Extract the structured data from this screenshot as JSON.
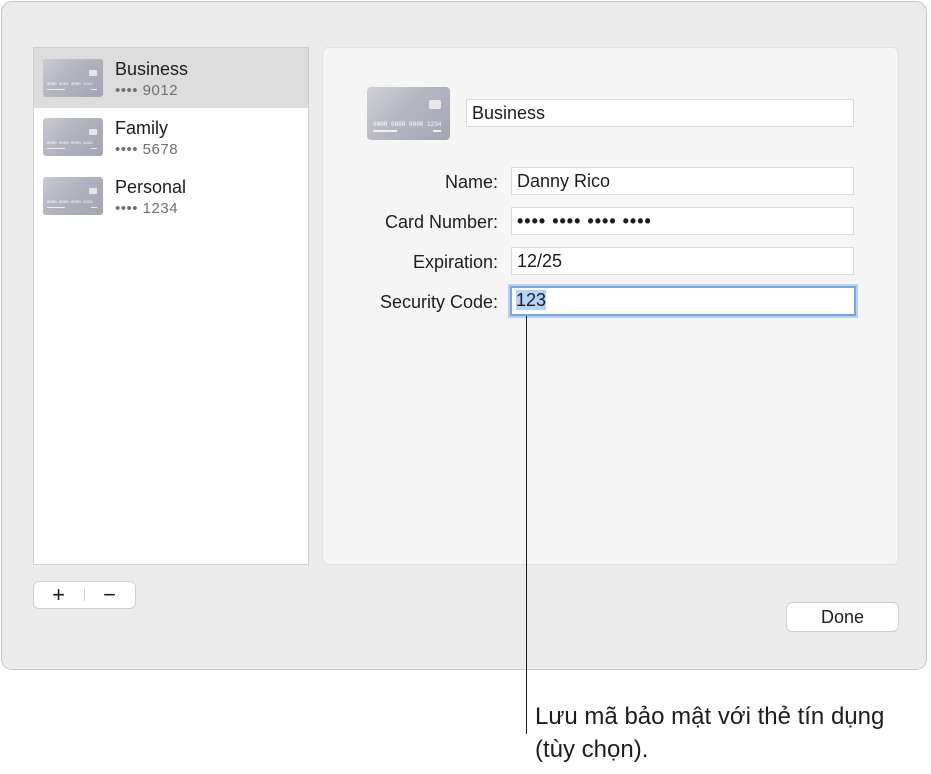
{
  "sidebar": {
    "items": [
      {
        "name": "Business",
        "number": "•••• 9012",
        "selected": true
      },
      {
        "name": "Family",
        "number": "•••• 5678",
        "selected": false
      },
      {
        "name": "Personal",
        "number": "•••• 1234",
        "selected": false
      }
    ],
    "card_thumbnail_text": "0000 0000 0000 1234"
  },
  "detail": {
    "card_title": "Business",
    "card_image_text": "0000 0000 0000 1234",
    "fields": {
      "name_label": "Name:",
      "name_value": "Danny Rico",
      "card_number_label": "Card Number:",
      "card_number_value": "•••• •••• •••• ••••",
      "expiration_label": "Expiration:",
      "expiration_value": "12/25",
      "security_code_label": "Security Code:",
      "security_code_value": "123"
    }
  },
  "footer": {
    "add_label": "+",
    "remove_label": "−",
    "done_label": "Done"
  },
  "callout": {
    "text": "Lưu mã bảo mật với thẻ tín dụng (tùy chọn)."
  },
  "colors": {
    "window_bg": "#ececec",
    "selection_bg": "#dcdcdc",
    "focus_ring": "#7aa7e0",
    "text_selection": "#b3d3f8"
  }
}
